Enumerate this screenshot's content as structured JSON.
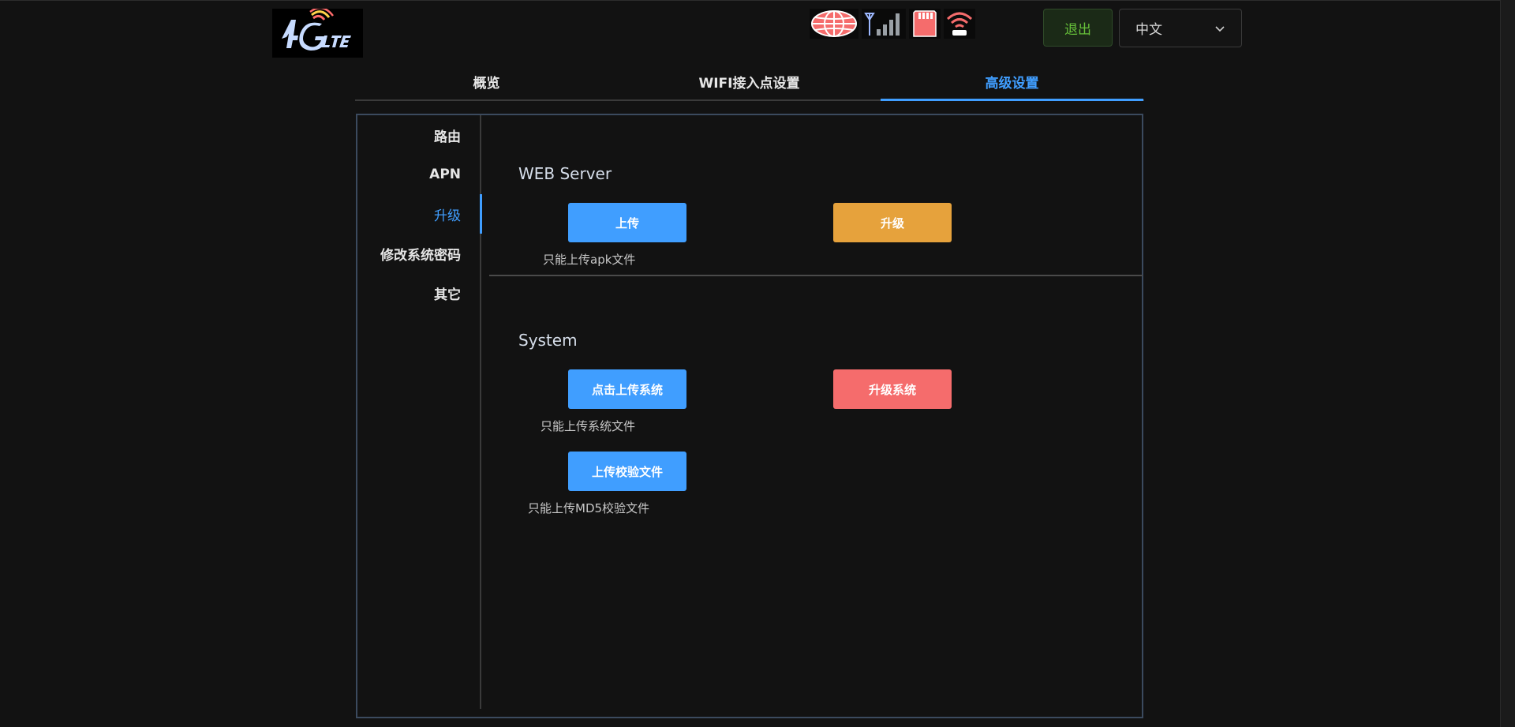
{
  "header": {
    "logout_label": "退出",
    "language": {
      "selected": "中文"
    }
  },
  "tabs": [
    {
      "label": "概览"
    },
    {
      "label": "WIFI接入点设置"
    },
    {
      "label": "高级设置"
    }
  ],
  "side_menu": [
    {
      "label": "路由"
    },
    {
      "label": "APN"
    },
    {
      "label": "升级"
    },
    {
      "label": "修改系统密码"
    },
    {
      "label": "其它"
    }
  ],
  "web_server": {
    "title": "WEB Server",
    "upload_label": "上传",
    "upgrade_label": "升级",
    "hint": "只能上传apk文件"
  },
  "system": {
    "title": "System",
    "upload_system_label": "点击上传系统",
    "upgrade_system_label": "升级系统",
    "upload_system_hint": "只能上传系统文件",
    "upload_checksum_label": "上传校验文件",
    "upload_checksum_hint": "只能上传MD5校验文件"
  },
  "colors": {
    "accent": "#409eff",
    "warning": "#e6a23c",
    "danger": "#f56c6c",
    "success": "#67c23a",
    "background": "#121212"
  },
  "icons": [
    "globe-icon",
    "signal-strength-icon",
    "sd-card-icon",
    "wifi-hotspot-icon"
  ]
}
